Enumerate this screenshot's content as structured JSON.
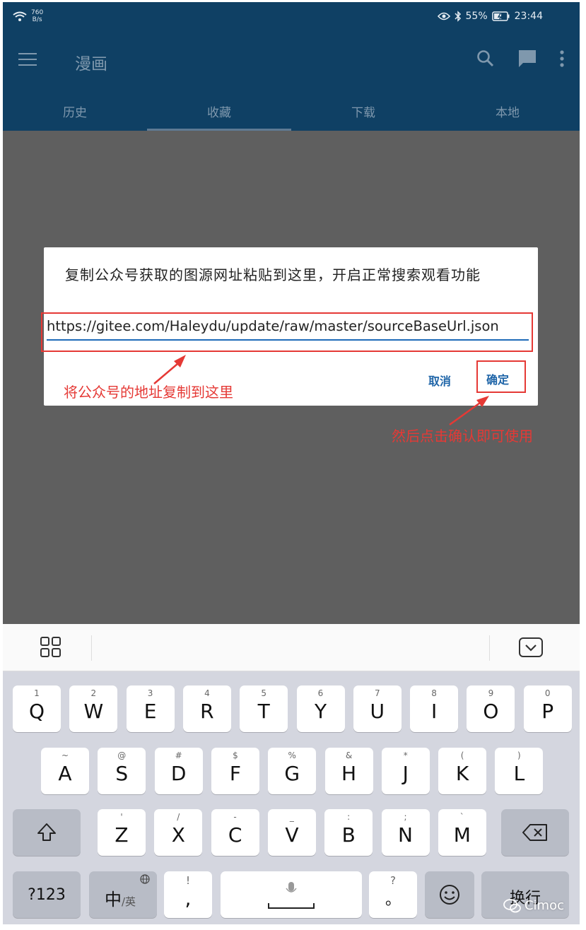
{
  "status_bar": {
    "speed_value": "760",
    "speed_unit": "B/s",
    "battery": "55%",
    "time": "23:44"
  },
  "toolbar": {
    "title": "漫画"
  },
  "tabs": [
    "历史",
    "收藏",
    "下载",
    "本地"
  ],
  "dialog": {
    "message": "复制公众号获取的图源网址粘贴到这里，开启正常搜索观看功能",
    "url_value": "https://gitee.com/Haleydu/update/raw/master/sourceBaseUrl.json",
    "cancel_label": "取消",
    "confirm_label": "确定"
  },
  "annotations": {
    "paste_hint": "将公众号的地址复制到这里",
    "confirm_hint": "然后点击确认即可使用"
  },
  "keyboard": {
    "row1": [
      {
        "hint": "1",
        "key": "Q"
      },
      {
        "hint": "2",
        "key": "W"
      },
      {
        "hint": "3",
        "key": "E"
      },
      {
        "hint": "4",
        "key": "R"
      },
      {
        "hint": "5",
        "key": "T"
      },
      {
        "hint": "6",
        "key": "Y"
      },
      {
        "hint": "7",
        "key": "U"
      },
      {
        "hint": "8",
        "key": "I"
      },
      {
        "hint": "9",
        "key": "O"
      },
      {
        "hint": "0",
        "key": "P"
      }
    ],
    "row2": [
      {
        "hint": "~",
        "key": "A"
      },
      {
        "hint": "@",
        "key": "S"
      },
      {
        "hint": "#",
        "key": "D"
      },
      {
        "hint": "$",
        "key": "F"
      },
      {
        "hint": "%",
        "key": "G"
      },
      {
        "hint": "&",
        "key": "H"
      },
      {
        "hint": "*",
        "key": "J"
      },
      {
        "hint": "(",
        "key": "K"
      },
      {
        "hint": ")",
        "key": "L"
      }
    ],
    "row3": [
      {
        "hint": "'",
        "key": "Z"
      },
      {
        "hint": "/",
        "key": "X"
      },
      {
        "hint": "-",
        "key": "C"
      },
      {
        "hint": "_",
        "key": "V"
      },
      {
        "hint": ":",
        "key": "B"
      },
      {
        "hint": ";",
        "key": "N"
      },
      {
        "hint": "`",
        "key": "M"
      }
    ],
    "symbols_label": "?123",
    "lang_main": "中",
    "lang_sub": "/英",
    "comma_hint": "!",
    "comma_key": ",",
    "period_hint": "?",
    "period_key": "。",
    "enter_label": "换行"
  },
  "watermark": "Cimoc"
}
